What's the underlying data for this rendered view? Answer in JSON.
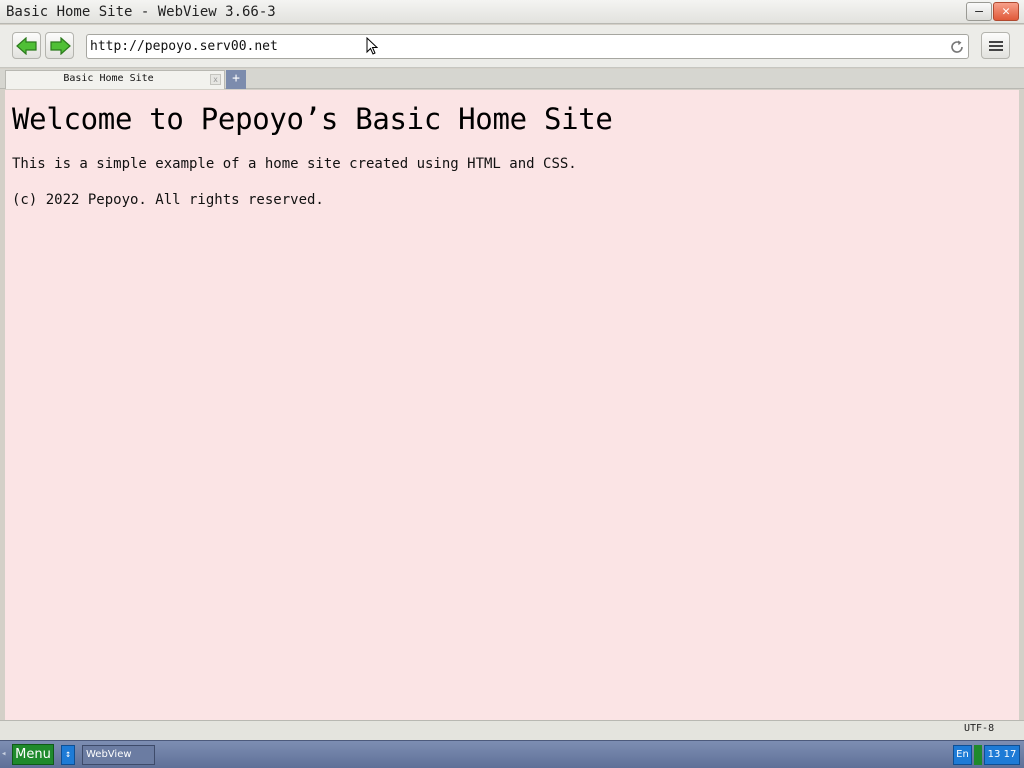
{
  "window": {
    "title": "Basic Home Site - WebView 3.66-3",
    "minimize_label": "–",
    "close_label": "✕"
  },
  "toolbar": {
    "url": "http://pepoyo.serv00.net"
  },
  "tabs": {
    "active_label": "Basic Home Site",
    "close_label": "x",
    "new_tab_label": "+"
  },
  "page": {
    "heading": "Welcome to Pepoyo’s Basic Home Site",
    "intro": "This is a simple example of a home site created using HTML and CSS.",
    "copyright": "(c) 2022 Pepoyo. All rights reserved.",
    "background_color": "#fbe4e5"
  },
  "status": {
    "encoding": "UTF-8"
  },
  "taskbar": {
    "menu_label": "Menu",
    "switcher_glyph": "↕",
    "task_label": "WebView",
    "lang_label": "En",
    "clock": "13 17",
    "left_arrow": "◂"
  },
  "icons": {
    "back": "back-arrow-icon",
    "forward": "forward-arrow-icon",
    "reload": "reload-icon",
    "menu": "hamburger-menu-icon",
    "cursor": "mouse-cursor-icon"
  },
  "colors": {
    "arrow_green": "#3faa2c",
    "taskbar_blue": "#6b7ca2",
    "menu_green": "#1f8a2c",
    "accent_blue": "#1e7bd6"
  }
}
